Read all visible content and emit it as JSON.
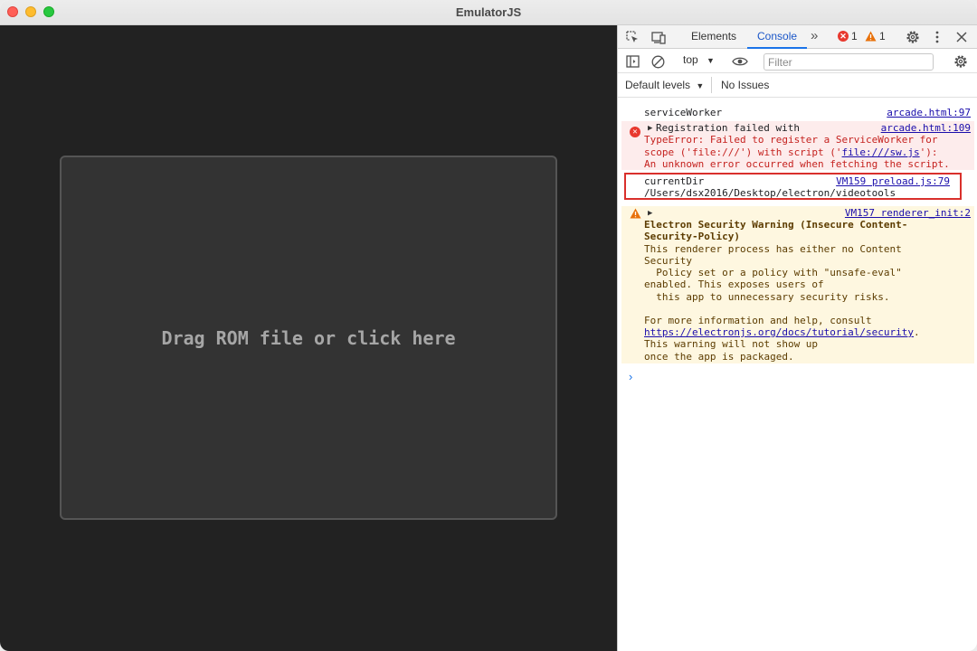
{
  "window": {
    "title": "EmulatorJS"
  },
  "emulator": {
    "drop_text": "Drag ROM file or click here"
  },
  "devtools": {
    "tabs": [
      "Elements",
      "Console"
    ],
    "more_tabs": "»",
    "error_count": "1",
    "warning_count": "1",
    "context": "top",
    "filter_placeholder": "Filter",
    "levels": "Default levels",
    "issues": "No Issues",
    "messages": {
      "log": {
        "text": "serviceWorker",
        "source": "arcade.html:97"
      },
      "error": {
        "source": "arcade.html:109",
        "line1": "Registration failed with",
        "line2": "TypeError: Failed to register a ServiceWorker for",
        "line3_pre": "scope ('file:///') with script ('",
        "line3_link": "file:///sw.js",
        "line3_post": "'):",
        "line4": "An unknown error occurred when fetching the script."
      },
      "dir": {
        "label": "currentDir",
        "source": "VM159 preload.js:79",
        "value": "/Users/dsx2016/Desktop/electron/videotools"
      },
      "warning": {
        "source": "VM157 renderer_init:2",
        "title1": "Electron Security Warning (Insecure Content-",
        "title2": "Security-Policy)",
        "body1": "This renderer process has either no Content",
        "body2": "Security",
        "body3": "  Policy set or a policy with \"unsafe-eval\"",
        "body4": "enabled. This exposes users of",
        "body5": "  this app to unnecessary security risks.",
        "more1": "For more information and help, consult",
        "more_link": "https://electronjs.org/docs/tutorial/security",
        "more_link_suffix": ".",
        "more3": "This warning will not show up",
        "more4": "once the app is packaged."
      }
    },
    "prompt": "›"
  }
}
